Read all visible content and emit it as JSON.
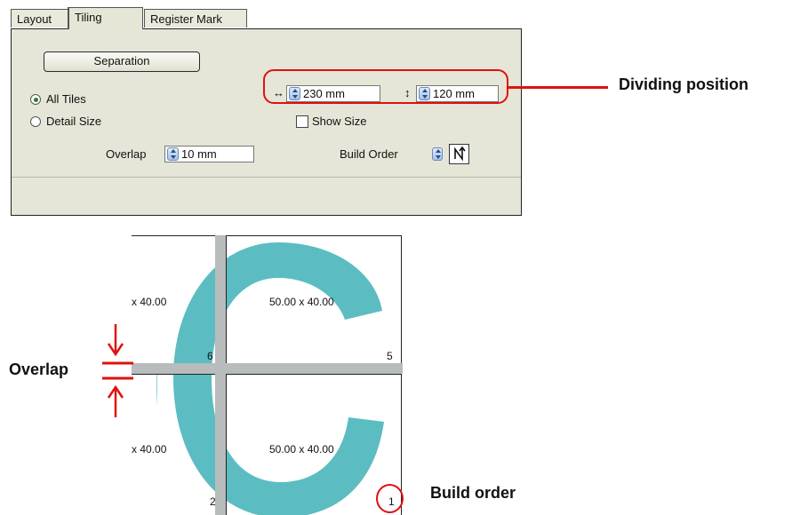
{
  "tabs": [
    "Layout",
    "Tiling",
    "Register Mark"
  ],
  "panel": {
    "separation_button": "Separation",
    "radio_all_tiles": "All Tiles",
    "radio_detail_size": "Detail Size",
    "horizontal_arrow": "↔",
    "horizontal_value": "230 mm",
    "vertical_arrow": "↕",
    "vertical_value": "120 mm",
    "show_size_label": "Show Size",
    "overlap_label": "Overlap",
    "overlap_value": "10 mm",
    "build_order_label": "Build Order",
    "selected_radio": "All Tiles"
  },
  "preview": {
    "tile_size_left_top": "x 40.00",
    "tile_size_right_top": "50.00 x 40.00",
    "tile_size_left_bottom": "x 40.00",
    "tile_size_right_bottom": "50.00 x 40.00",
    "tile_number_6": "6",
    "tile_number_5": "5",
    "tile_number_2": "2",
    "tile_number_1": "1",
    "letter_color": "#5bbdc2",
    "overlap_bar_color": "#b8bcbc"
  },
  "callouts": {
    "dividing_position": "Dividing position",
    "overlap": "Overlap",
    "build_order": "Build order",
    "accent_color": "#e01010"
  }
}
